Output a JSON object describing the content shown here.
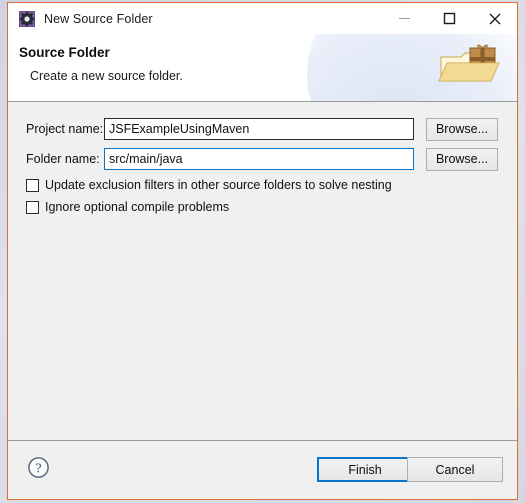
{
  "window": {
    "title": "New Source Folder",
    "icon": "eclipse-gear-icon",
    "border_color": "#e06a3a",
    "controls": {
      "minimize": "—",
      "maximize": "□",
      "close": "✕"
    }
  },
  "header": {
    "title": "Source Folder",
    "subtitle": "Create a new source folder.",
    "art": "folder-with-gift-icon"
  },
  "form": {
    "fields": [
      {
        "label": "Project name:",
        "value": "JSFExampleUsingMaven",
        "placeholder": "",
        "focused": false,
        "browse_label": "Browse..."
      },
      {
        "label": "Folder name:",
        "value": "src/main/java",
        "placeholder": "",
        "focused": true,
        "browse_label": "Browse..."
      }
    ],
    "checkboxes": [
      {
        "label": "Update exclusion filters in other source folders to solve nesting",
        "checked": false
      },
      {
        "label": "Ignore optional compile problems",
        "checked": false
      }
    ]
  },
  "footer": {
    "help_icon": "help-question-icon",
    "finish_label": "Finish",
    "cancel_label": "Cancel",
    "default_button": "Finish",
    "accent_color": "#0a74c8"
  }
}
